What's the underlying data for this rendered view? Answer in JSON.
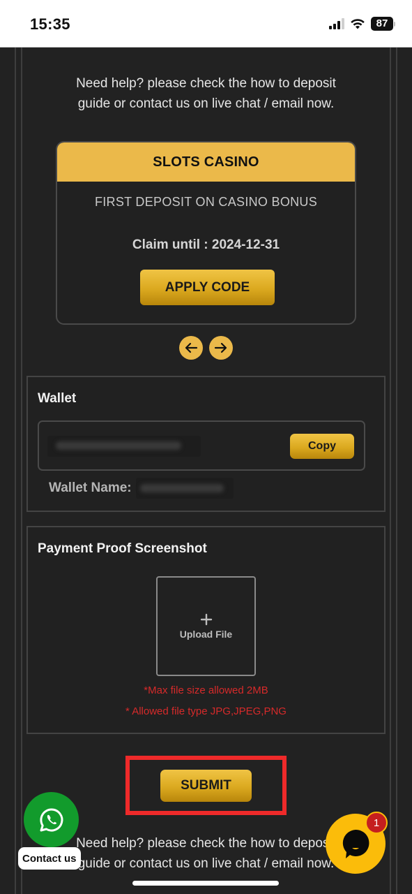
{
  "status_bar": {
    "time": "15:35",
    "battery": "87",
    "icons": [
      "cellular-signal-icon",
      "wifi-icon",
      "battery-icon"
    ]
  },
  "help": {
    "line1": "Need help? please check the how to deposit",
    "line2": "guide or contact us on live chat / email now."
  },
  "promo": {
    "title": "SLOTS CASINO",
    "description": "FIRST DEPOSIT ON CASINO BONUS",
    "claim_until": "Claim until : 2024-12-31",
    "apply_label": "APPLY CODE",
    "prev_icon": "arrow-left-icon",
    "next_icon": "arrow-right-icon",
    "accent_color": "#ebb94a"
  },
  "wallet": {
    "title": "Wallet",
    "address": "[redacted]",
    "copy_label": "Copy",
    "name_label": "Wallet Name:",
    "name_value": "[redacted]"
  },
  "payment_proof": {
    "title": "Payment Proof Screenshot",
    "upload_icon": "plus-icon",
    "upload_label": "Upload File",
    "note_size": "*Max file size allowed 2MB",
    "note_type": "* Allowed file type JPG,JPEG,PNG",
    "note_color": "#d62a2a"
  },
  "submit": {
    "label": "SUBMIT",
    "highlight_color": "#ef2a2a"
  },
  "floating": {
    "whatsapp_icon": "whatsapp-icon",
    "contact_label": "Contact us",
    "chat_icon": "chat-bubble-icon",
    "chat_badge": "1"
  }
}
